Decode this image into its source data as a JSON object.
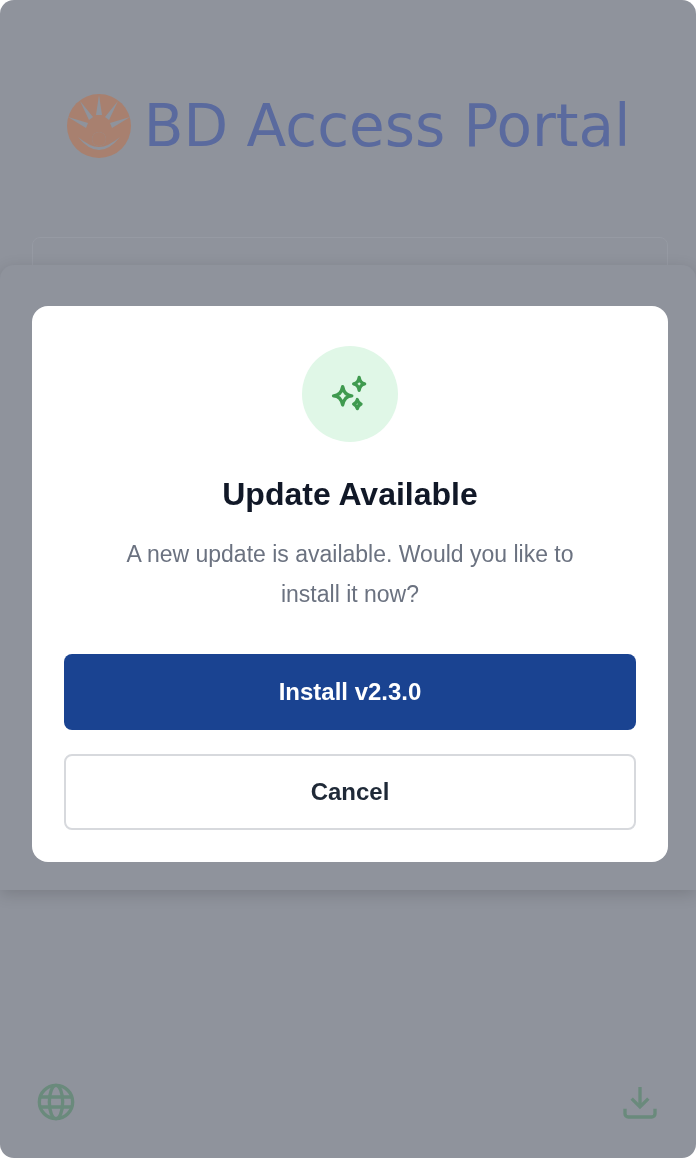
{
  "logo": {
    "text": "BD Access Portal"
  },
  "dialog": {
    "title": "Update Available",
    "message": "A new update is available. Would you like to install it now?",
    "buttons": [
      {
        "label": "Install v2.3.0",
        "kind": "primary"
      },
      {
        "label": "Cancel",
        "kind": "secondary"
      }
    ]
  }
}
